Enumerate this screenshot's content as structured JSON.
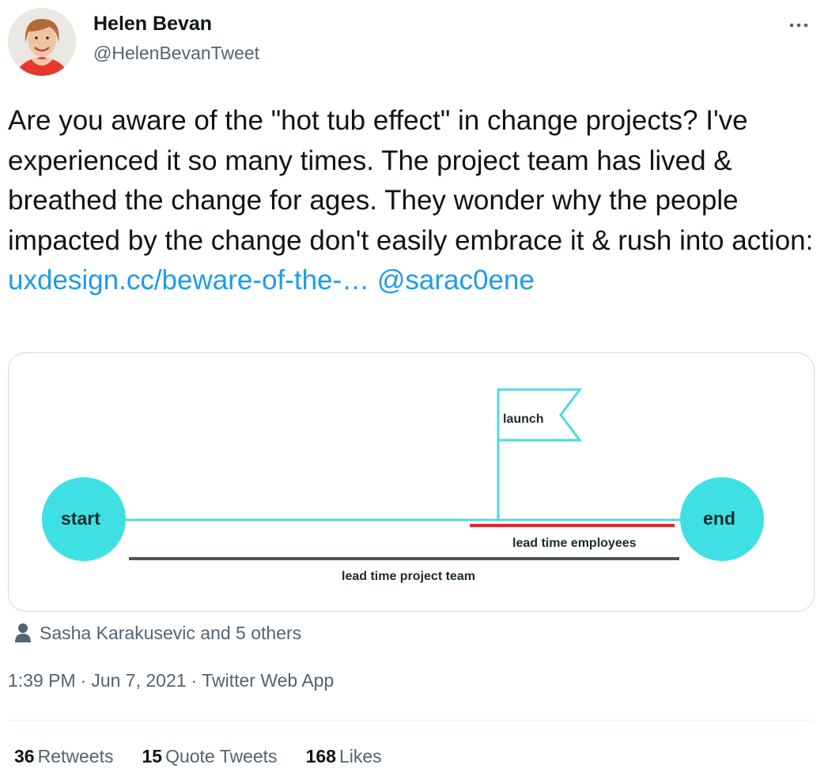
{
  "author": {
    "name": "Helen Bevan",
    "handle": "@HelenBevanTweet"
  },
  "tweet": {
    "text": "Are you aware of the \"hot tub effect\" in change projects? I've experienced it so many times. The project team has lived & breathed the change for ages. They wonder why the people impacted by the change don't easily embrace it & rush into action:",
    "link_text": "uxdesign.cc/beware-of-the-…",
    "mention_text": "@sarac0ene"
  },
  "media": {
    "start_label": "start",
    "end_label": "end",
    "launch_label": "launch",
    "employees_label": "lead time employees",
    "team_label": "lead time project team",
    "colors": {
      "timeline": "#4fd9de",
      "circle": "#3ee0e3",
      "employees_bar": "#e0262b",
      "team_bar": "#4a5558"
    }
  },
  "tagged": {
    "icon": "person-icon",
    "text": "Sasha Karakusevic and 5 others"
  },
  "meta": {
    "time": "1:39 PM",
    "date": "Jun 7, 2021",
    "source": "Twitter Web App",
    "separator": "·"
  },
  "stats": {
    "retweets_count": "36",
    "retweets_label": "Retweets",
    "quotes_count": "15",
    "quotes_label": "Quote Tweets",
    "likes_count": "168",
    "likes_label": "Likes"
  },
  "colors": {
    "link": "#1d9bf0",
    "secondary_text": "#536471",
    "primary_text": "#0f1419"
  }
}
